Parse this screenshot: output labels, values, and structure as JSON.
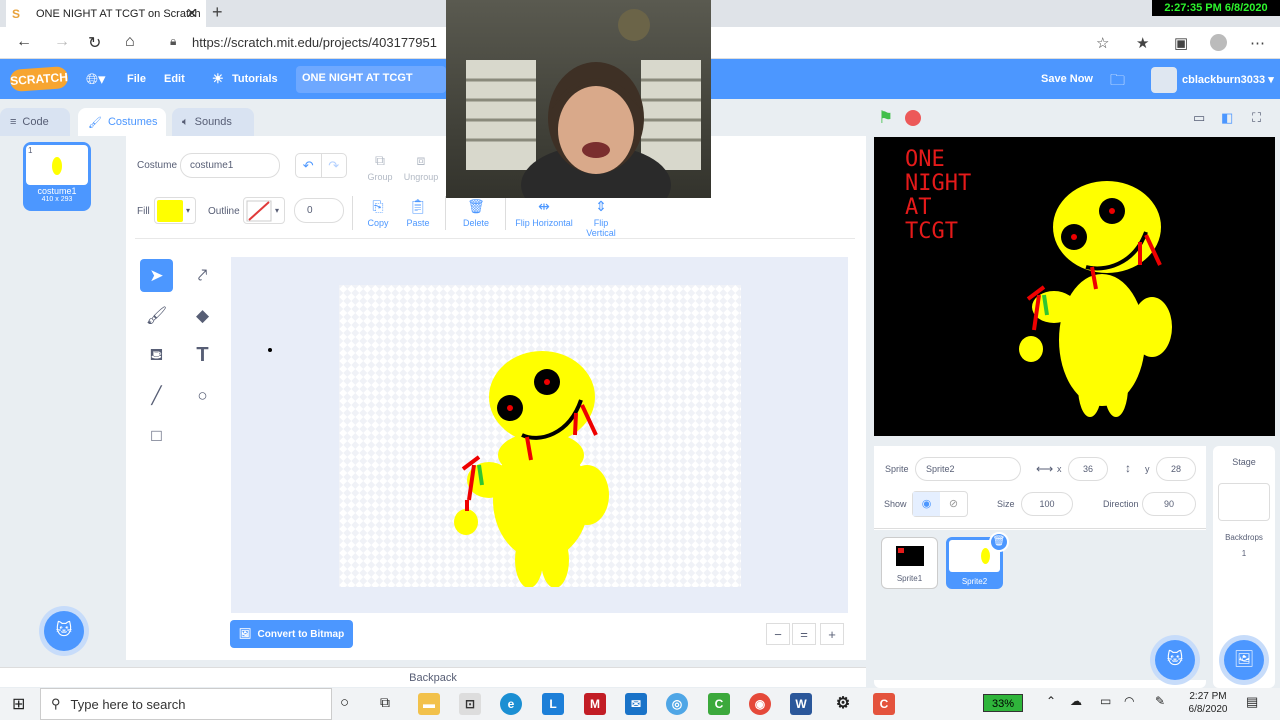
{
  "browser": {
    "tab_title": "ONE NIGHT AT TCGT on Scratch",
    "url": "https://scratch.mit.edu/projects/403177951",
    "overlay_clock": "2:27:35 PM 6/8/2020"
  },
  "menubar": {
    "logo": "SCRATCH",
    "file": "File",
    "edit": "Edit",
    "tutorials": "Tutorials",
    "project_title": "ONE NIGHT AT TCGT",
    "save_now": "Save Now",
    "username": "cblackburn3033"
  },
  "tabs": {
    "code": "Code",
    "costumes": "Costumes",
    "sounds": "Sounds"
  },
  "costume_list": [
    {
      "index": "1",
      "name": "costume1",
      "size": "410 x 293"
    }
  ],
  "editor": {
    "costume_label": "Costume",
    "costume_name": "costume1",
    "group": "Group",
    "ungroup": "Ungroup",
    "fill_label": "Fill",
    "outline_label": "Outline",
    "outline_width": "0",
    "copy": "Copy",
    "paste": "Paste",
    "delete": "Delete",
    "flip_horizontal": "Flip Horizontal",
    "flip_vertical": "Flip Vertical",
    "convert_button": "Convert to Bitmap",
    "fill_color": "#ffff00"
  },
  "backpack": "Backpack",
  "stage": {
    "title_text": "ONE\nNIGHT\nAT\nTCGT"
  },
  "sprite_info": {
    "sprite_label": "Sprite",
    "sprite_name": "Sprite2",
    "x_label": "x",
    "x_value": "36",
    "y_label": "y",
    "y_value": "28",
    "show_label": "Show",
    "size_label": "Size",
    "size_value": "100",
    "direction_label": "Direction",
    "direction_value": "90"
  },
  "sprites": [
    {
      "name": "Sprite1"
    },
    {
      "name": "Sprite2"
    }
  ],
  "stage_panel": {
    "title": "Stage",
    "backdrops_label": "Backdrops",
    "backdrops_count": "1"
  },
  "taskbar": {
    "search_placeholder": "Type here to search",
    "battery": "33%",
    "time": "2:27 PM",
    "date": "6/8/2020"
  },
  "colors": {
    "accent": "#4c97ff",
    "menubar": "#4c97ff",
    "stage_text": "#e51a1a"
  }
}
